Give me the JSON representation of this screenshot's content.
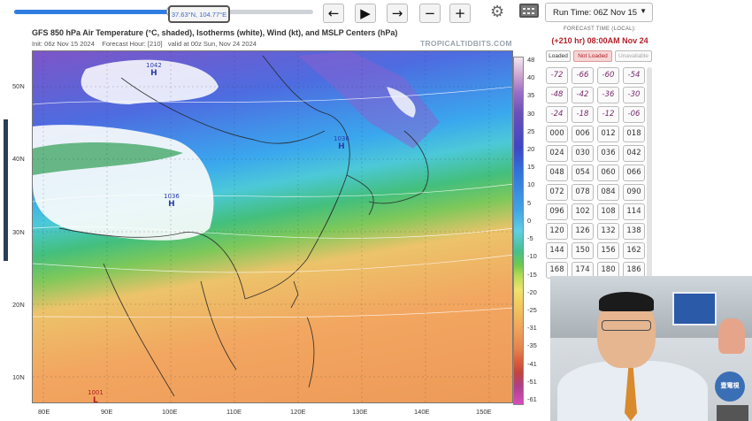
{
  "toolbar": {
    "cursor_readout": "37.63°N, 104.77°E",
    "prev_label": "←",
    "play_label": "▶",
    "next_label": "→",
    "zoom_out_label": "−",
    "zoom_in_label": "+",
    "run_time_selected": "Run Time: 06Z Nov 15",
    "slider_progress": 0.53
  },
  "map_header": {
    "title": "GFS 850 hPa Air Temperature (°C, shaded), Isotherms (white), Wind (kt), and MSLP Centers (hPa)",
    "init_text": "Init: 06z Nov 15 2024",
    "forecast_hour_text": "Forecast Hour: [210]",
    "valid_text": "valid at 00z Sun, Nov 24 2024",
    "brand": "TROPICALTIDBITS.COM"
  },
  "pressure_centers": [
    {
      "type": "H",
      "value": "1042"
    },
    {
      "type": "H",
      "value": "1036"
    },
    {
      "type": "H",
      "value": "1036"
    },
    {
      "type": "L",
      "value": "1001"
    }
  ],
  "lat_labels": [
    "50N",
    "40N",
    "30N",
    "20N",
    "10N"
  ],
  "lon_labels": [
    "80E",
    "90E",
    "100E",
    "110E",
    "120E",
    "130E",
    "140E",
    "150E"
  ],
  "colorbar_ticks": [
    "48",
    "40",
    "35",
    "30",
    "25",
    "20",
    "15",
    "10",
    "5",
    "0",
    "-5",
    "-10",
    "-15",
    "-20",
    "-25",
    "-31",
    "-35",
    "-41",
    "-51",
    "-61"
  ],
  "forecast_panel": {
    "header": "FORECAST TIME (LOCAL):",
    "time": "(+210 hr) 08:00AM Nov 24",
    "status": [
      "Loaded",
      "Not Loaded",
      "Unavailable"
    ],
    "hours": [
      "-72",
      "-66",
      "-60",
      "-54",
      "-48",
      "-42",
      "-36",
      "-30",
      "-24",
      "-18",
      "-12",
      "-06",
      "000",
      "006",
      "012",
      "018",
      "024",
      "030",
      "036",
      "042",
      "048",
      "054",
      "060",
      "066",
      "072",
      "078",
      "084",
      "090",
      "096",
      "102",
      "108",
      "114",
      "120",
      "126",
      "132",
      "138",
      "144",
      "150",
      "156",
      "162",
      "168",
      "174",
      "180",
      "186"
    ]
  },
  "webcam_logo": "壹電視"
}
